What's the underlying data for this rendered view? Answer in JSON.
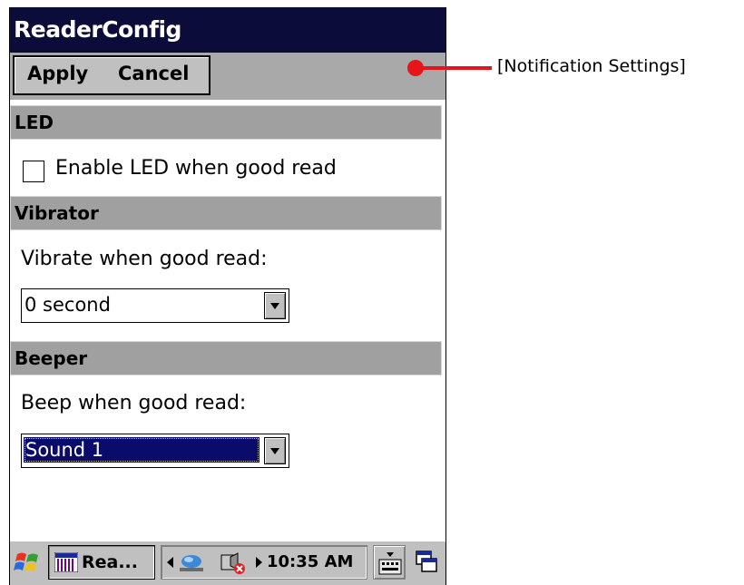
{
  "window": {
    "title": "ReaderConfig"
  },
  "menu": {
    "apply_label": "Apply",
    "cancel_label": "Cancel"
  },
  "led": {
    "section_title": "LED",
    "checkbox_label": "Enable LED when good read",
    "checked": false
  },
  "vibrator": {
    "section_title": "Vibrator",
    "prompt": "Vibrate when good read:",
    "selected_value": "0 second"
  },
  "beeper": {
    "section_title": "Beeper",
    "prompt": "Beep when good read:",
    "selected_value": "Sound 1"
  },
  "taskbar": {
    "task_label": "Rea...",
    "clock": "10:35 AM"
  },
  "callout": {
    "label": "[Notification Settings]",
    "color": "#e8141a"
  },
  "icons": {
    "start": "windows-flag-icon",
    "task_app": "app-grid-icon",
    "network": "network-connection-icon",
    "volume": "volume-muted-icon",
    "keyboard": "keyboard-icon",
    "desktop": "show-desktop-icon"
  },
  "colors": {
    "titlebar": "#0c0c3a",
    "section": "#a0a0a0",
    "menubar": "#a9a9a9",
    "selection": "#0b0b6b"
  }
}
